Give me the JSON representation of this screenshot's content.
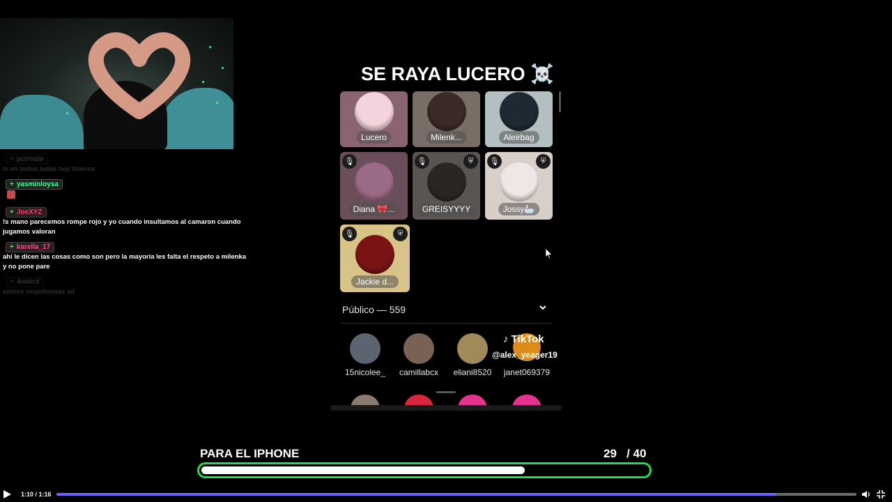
{
  "overlay": {
    "title": "SE RAYA LUCERO ☠️"
  },
  "chat": [
    {
      "user": "pctrvalo",
      "text": "is en todos lados hay tóxicos",
      "color": "#888888",
      "faded": true
    },
    {
      "user": "yasminloysa",
      "text": "",
      "color": "#3cff9a",
      "emote": true,
      "faded": false
    },
    {
      "user": "JoeXYZ",
      "text": "!s mano parecemos rompe rojo y yo cuando insultamos al camaron cuando jugamos valoran",
      "color": "#ff3b5c",
      "faded": false
    },
    {
      "user": "karella_17",
      "text": "ahí le dicen las cosas como son pero la mayoría les falta el respeto a milenka y no pone pare",
      "color": "#ff4d8d",
      "faded": false
    },
    {
      "user": "4nwtrd",
      "text": "somos respetuosas xd",
      "color": "#888888",
      "faded": true
    }
  ],
  "speakers": [
    {
      "name": "Lucero",
      "bg": "#8a6470",
      "avatar": "#f3d3dc"
    },
    {
      "name": "Milenk...",
      "bg": "#7a6d66",
      "avatar": "#3a2a26"
    },
    {
      "name": "Aleirbag",
      "bg": "#b3bfc0",
      "avatar": "#1e2a33"
    },
    {
      "name": "Diana 🎀...",
      "bg": "#6a4e5a",
      "avatar": "#9b6a86"
    },
    {
      "name": "GREISYYYY",
      "bg": "#5a5552",
      "avatar": "#2b2624"
    },
    {
      "name": "Jossy🦢",
      "bg": "#d9cfc9",
      "avatar": "#f1e6e6"
    },
    {
      "name": "Jackie d...",
      "bg": "#d8c487",
      "avatar": "#7a1414"
    }
  ],
  "public": {
    "label": "Público — 559"
  },
  "listeners": [
    {
      "name": "15nicolee_",
      "color": "#5b6470"
    },
    {
      "name": "camillabcx",
      "color": "#7a6156"
    },
    {
      "name": "eliani8520",
      "color": "#a18a5a"
    },
    {
      "name": "janet069379",
      "color": "#f39b1c"
    }
  ],
  "tiktok": {
    "logo": "♪ TikTok",
    "handle": "@alex_yeager19"
  },
  "peek_colors": [
    "#8b7a70",
    "#d7263d",
    "#e4338c",
    "#e4338c"
  ],
  "goal": {
    "label": "PARA EL IPHONE",
    "current": 29,
    "count_text": "29   / 40",
    "target": 40
  },
  "player": {
    "time": "1:10 / 1:16",
    "progress": 0.9
  }
}
